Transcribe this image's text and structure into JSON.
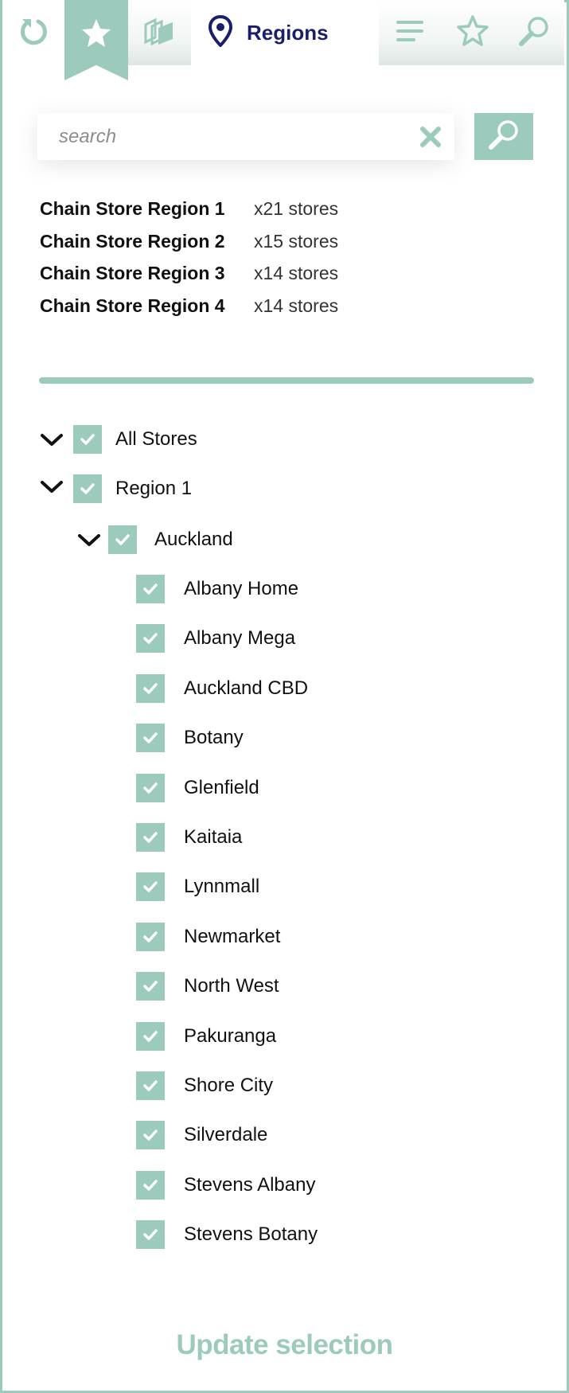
{
  "tabs": [
    {
      "name": "reset-tab",
      "icon": "refresh-icon"
    },
    {
      "name": "favourites-tab",
      "icon": "star-filled-icon",
      "active": true
    },
    {
      "name": "layers-tab",
      "icon": "layers-icon"
    },
    {
      "name": "regions-tab",
      "icon": "map-pin-icon",
      "label": "Regions"
    },
    {
      "name": "list-tab",
      "icon": "list-icon"
    },
    {
      "name": "starred-tab",
      "icon": "star-outline-icon"
    },
    {
      "name": "search-tab",
      "icon": "magnifier-icon"
    }
  ],
  "search": {
    "placeholder": "search",
    "value": ""
  },
  "summary": [
    {
      "name": "Chain Store Region 1",
      "count": "x21 stores"
    },
    {
      "name": "Chain Store Region 2",
      "count": "x15 stores"
    },
    {
      "name": "Chain Store Region 3",
      "count": "x14 stores"
    },
    {
      "name": "Chain Store Region 4",
      "count": "x14 stores"
    }
  ],
  "tree": {
    "root": {
      "label": "All Stores",
      "checked": true,
      "expanded": true
    },
    "region": {
      "label": "Region 1",
      "checked": true,
      "expanded": true
    },
    "area": {
      "label": "Auckland",
      "checked": true,
      "expanded": true
    },
    "stores": [
      {
        "label": "Albany Home",
        "checked": true
      },
      {
        "label": "Albany Mega",
        "checked": true
      },
      {
        "label": "Auckland CBD",
        "checked": true
      },
      {
        "label": "Botany",
        "checked": true
      },
      {
        "label": "Glenfield",
        "checked": true
      },
      {
        "label": "Kaitaia",
        "checked": true
      },
      {
        "label": "Lynnmall",
        "checked": true
      },
      {
        "label": "Newmarket",
        "checked": true
      },
      {
        "label": "North West",
        "checked": true
      },
      {
        "label": "Pakuranga",
        "checked": true
      },
      {
        "label": "Shore City",
        "checked": true
      },
      {
        "label": "Silverdale",
        "checked": true
      },
      {
        "label": "Stevens Albany",
        "checked": true
      },
      {
        "label": "Stevens Botany",
        "checked": true
      }
    ]
  },
  "footer": {
    "update_label": "Update selection"
  },
  "colors": {
    "accent": "#9ccabd",
    "title": "#1b1f6b",
    "text": "#111111"
  }
}
